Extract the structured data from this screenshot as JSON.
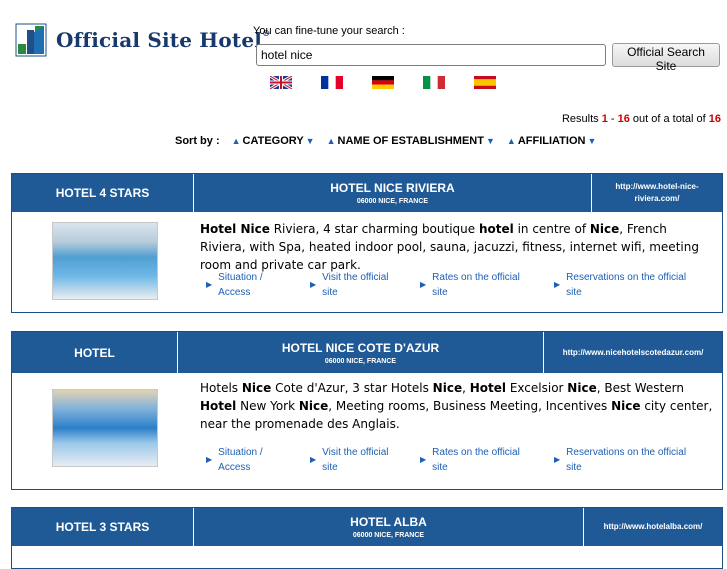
{
  "logo": {
    "text": "Official Site Hotel",
    "reg": "®"
  },
  "search": {
    "hint": "You can fine-tune your search :",
    "value": "hotel nice",
    "button_label": "Official Search Site"
  },
  "flags": [
    "uk-flag",
    "france-flag",
    "germany-flag",
    "italy-flag",
    "spain-flag"
  ],
  "results": {
    "prefix": "Results ",
    "from": "1",
    "dash": " - ",
    "to": "16",
    "middle": " out of a total of ",
    "total": "16"
  },
  "sort": {
    "label": "Sort by :",
    "items": [
      "CATEGORY",
      "NAME OF ESTABLISHMENT",
      "AFFILIATION"
    ]
  },
  "links": [
    "Situation / Access",
    "Visit the official site",
    "Rates on the official site",
    "Reservations on the official site"
  ],
  "hotels": [
    {
      "category": "HOTEL 4 STARS",
      "name": "HOTEL NICE RIVIERA",
      "address": "06000 NICE, FRANCE",
      "url": "http://www.hotel-nice-riviera.com/"
    },
    {
      "category": "HOTEL",
      "name": "HOTEL NICE COTE D'AZUR",
      "address": "06000 NICE, FRANCE",
      "url": "http://www.nicehotelscotedazur.com/"
    },
    {
      "category": "HOTEL 3 STARS",
      "name": "HOTEL ALBA",
      "address": "06000 NICE, FRANCE",
      "url": "http://www.hotelalba.com/"
    }
  ],
  "descriptions": [
    [
      "Hotel Nice",
      " Riviera, 4 star charming boutique ",
      "hotel",
      " in centre of ",
      "Nice",
      ", French Riviera, with Spa, heated indoor pool, sauna, jacuzzi, fitness, internet wifi, meeting room and private car park."
    ],
    [
      "Hotels ",
      "Nice",
      " Cote d'Azur, 3 star Hotels ",
      "Nice",
      ", ",
      "Hotel",
      " Excelsior ",
      "Nice",
      ", Best Western ",
      "Hotel",
      " New York ",
      "Nice",
      ", Meeting rooms, Business Meeting, Incentives ",
      "Nice",
      " city center, near the promenade des Anglais."
    ]
  ]
}
